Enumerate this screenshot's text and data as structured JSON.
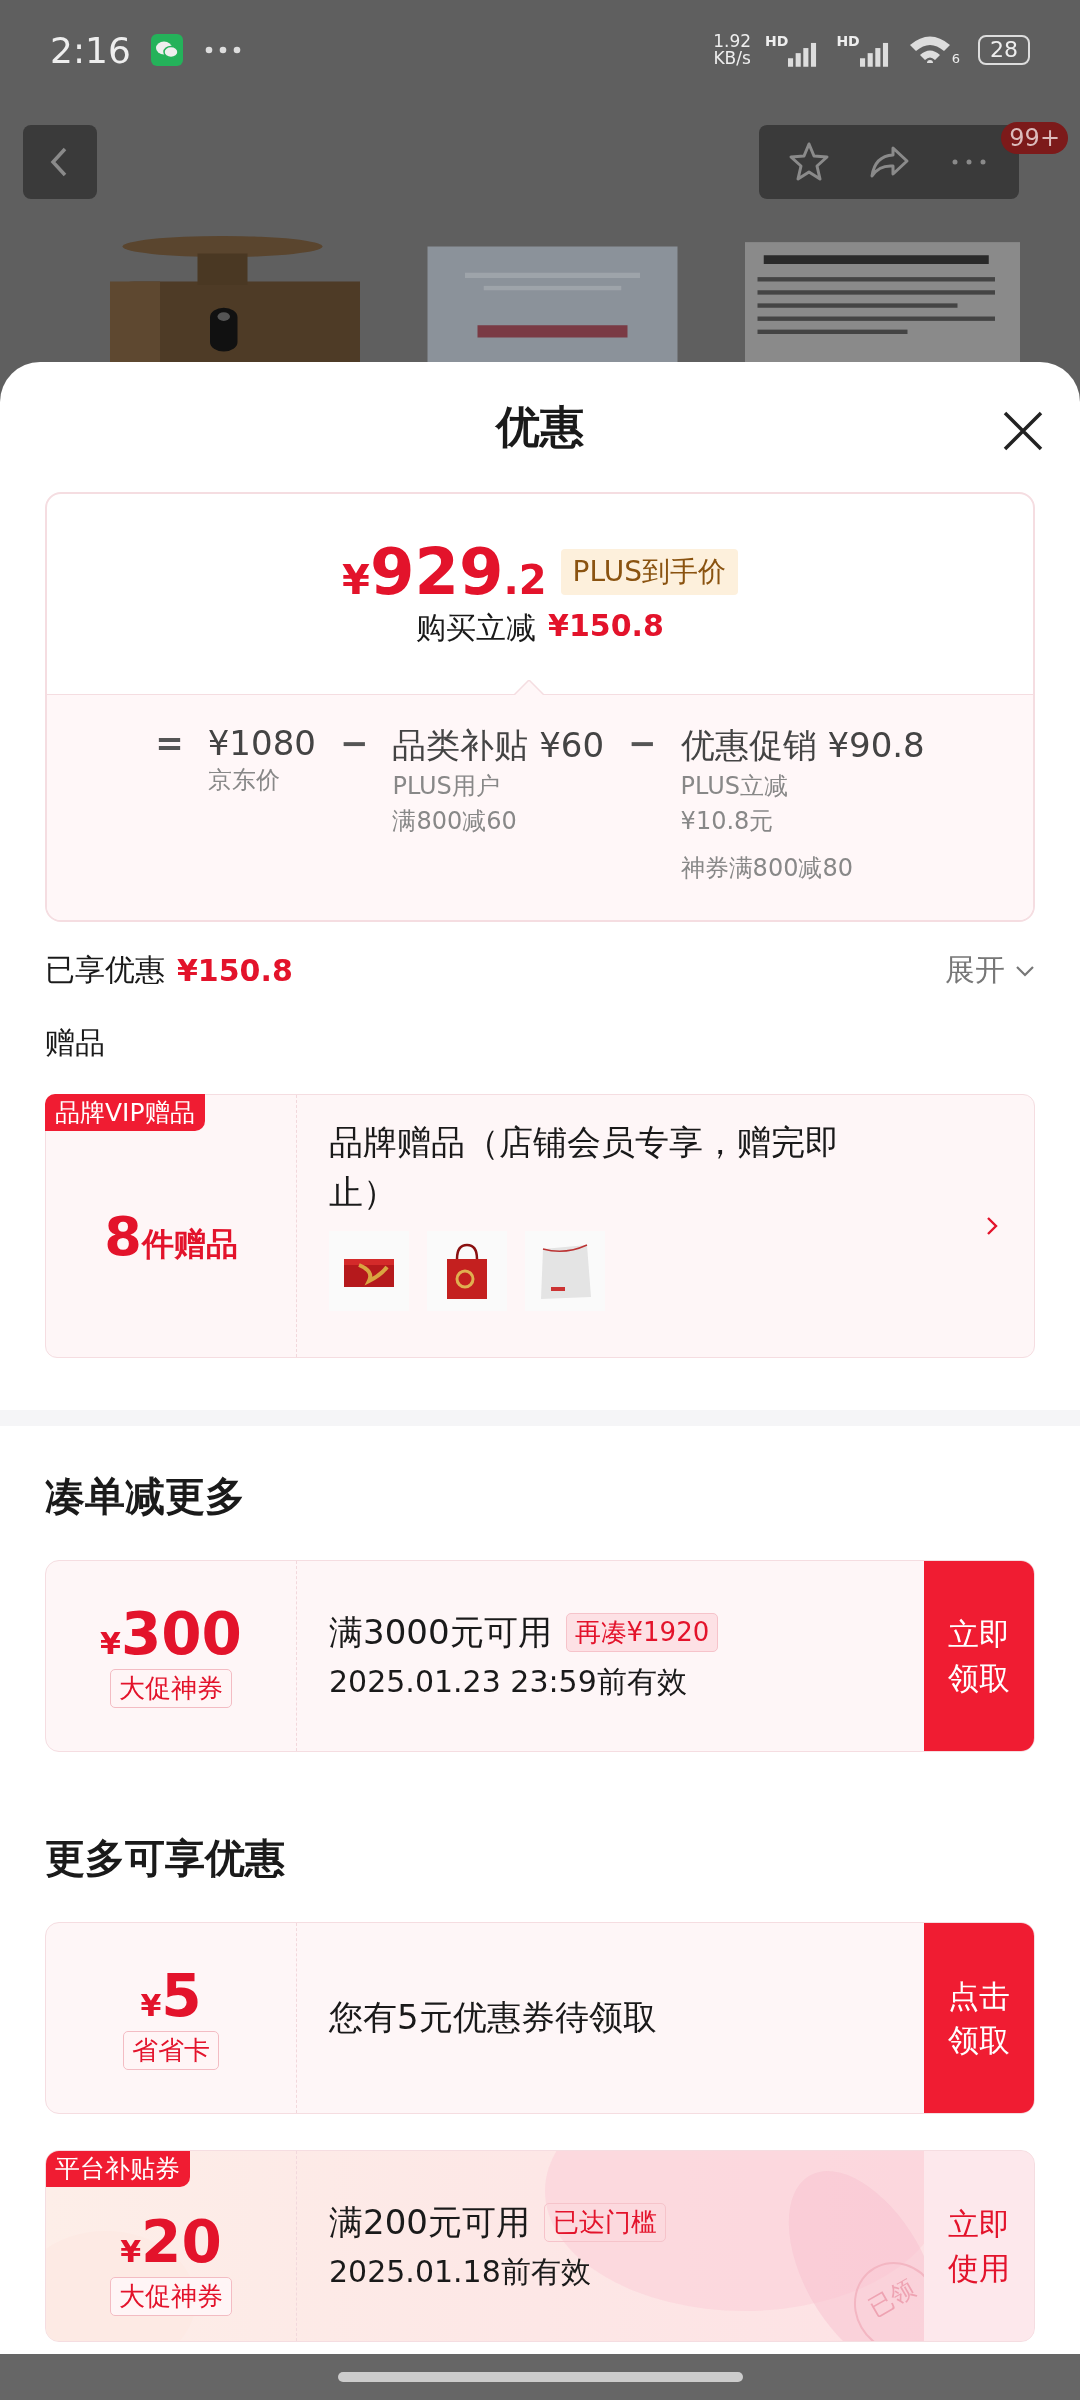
{
  "status_bar": {
    "time": "2:16",
    "net_speed_value": "1.92",
    "net_speed_unit": "KB/s",
    "signal_labels": [
      "HD",
      "HD"
    ],
    "wifi_label": "6",
    "battery": "28"
  },
  "page_header": {
    "badge": "99+"
  },
  "sheet": {
    "title": "优惠"
  },
  "price_summary": {
    "price_symbol": "¥",
    "price_main": "929",
    "price_decimal": ".2",
    "price_tag": "PLUS到手价",
    "saving_label": "购买立减",
    "saving_amount": "¥150.8",
    "breakdown": [
      {
        "operator": "=",
        "title": "¥1080",
        "notes": [
          [
            "京东价"
          ]
        ]
      },
      {
        "operator": "−",
        "title": "品类补贴 ¥60",
        "notes": [
          [
            "PLUS用户",
            "满800减60"
          ]
        ]
      },
      {
        "operator": "−",
        "title": "优惠促销 ¥90.8",
        "notes": [
          [
            "PLUS立减",
            "¥10.8元"
          ],
          [
            "神券满800减80"
          ]
        ]
      }
    ]
  },
  "savings_row": {
    "label": "已享优惠",
    "amount": "¥150.8",
    "expand": "展开"
  },
  "gifts": {
    "heading": "赠品",
    "corner_tag": "品牌VIP赠品",
    "count": "8",
    "count_unit": "件赠品",
    "title": "品牌赠品（店铺会员专享，赠完即止）"
  },
  "sections": [
    {
      "heading": "凑单减更多",
      "coupons": [
        {
          "kind": "standard",
          "symbol": "¥",
          "amount": "300",
          "label": "大促神券",
          "condition": "满3000元可用",
          "badge": "再凑¥1920",
          "validity": "2025.01.23 23:59前有效",
          "action": "立即领取"
        }
      ]
    },
    {
      "heading": "更多可享优惠",
      "coupons": [
        {
          "kind": "standard",
          "symbol": "¥",
          "amount": "5",
          "label": "省省卡",
          "condition": "您有5元优惠券待领取",
          "action": "点击领取"
        },
        {
          "kind": "claimed",
          "corner_tag": "平台补贴券",
          "symbol": "¥",
          "amount": "20",
          "label": "大促神券",
          "condition": "满200元可用",
          "badge": "已达门槛",
          "validity": "2025.01.18前有效",
          "action": "立即使用",
          "stamp": "已领"
        }
      ]
    }
  ]
}
